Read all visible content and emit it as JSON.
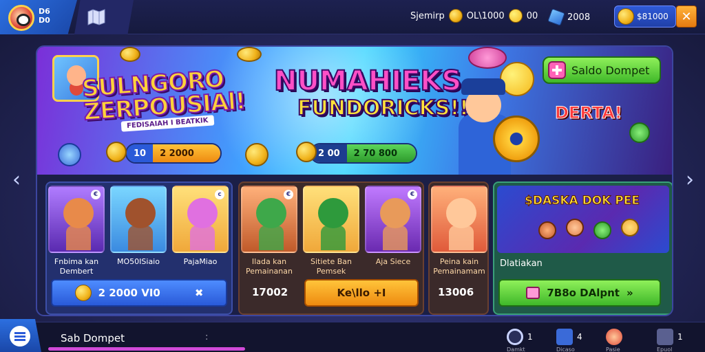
{
  "topbar": {
    "level_text": "D6\nD0",
    "stats_label": "Sjemirp",
    "stats_coins": "OL\\1000",
    "stats_value": "00",
    "gems": "2008",
    "wallet": "$81000",
    "close_glyph": "✕"
  },
  "banner": {
    "title_left": "SULNGORO ZERPOUSIAl!",
    "subtitle_left": "FEDISAIAH I BEATKIK",
    "title_main": "NUMAHIEKS",
    "title_main_2": "FUNDORICKS!!",
    "pill1_left": "10",
    "pill1_right": "2 2000",
    "pill2_left": "2 00",
    "pill2_right": "2 70 800",
    "saldo_button": "Saldo Dompet",
    "derta": "DERTA!"
  },
  "cards": {
    "group_a": {
      "labels": [
        "Fnbima kan Dembert",
        "MO50ISiaio",
        "PajaMiao"
      ],
      "badges": [
        "€",
        "",
        "c"
      ],
      "button_value": "2 2000 VI0",
      "button_icon": "✖"
    },
    "group_b": {
      "labels": [
        "Ilada kan Pemainanan",
        "Sitiete Ban Pemsek",
        "Aja Siece"
      ],
      "badges": [
        "€",
        "",
        "€"
      ],
      "value_left": "17002",
      "button_label": "Ke\\llo +I"
    },
    "orphan": {
      "label": "Peina kain Pemainamam",
      "value": "13006"
    },
    "promo": {
      "title": "$DASKA DOK PEE",
      "subtitle": "Dlatiakan",
      "button_value": "7B8o DAlpnt",
      "button_icon": "»"
    }
  },
  "bottombar": {
    "status_label": "Sab Dompet",
    "status_dots": ":",
    "nav": [
      {
        "icon": "record-icon",
        "value": "1",
        "caption": "Damkt"
      },
      {
        "icon": "gift-icon",
        "value": "4",
        "caption": "Dicaso"
      },
      {
        "icon": "profile-icon",
        "value": "",
        "caption": "Pasie"
      },
      {
        "icon": "bag-icon",
        "value": "1",
        "caption": "Epuol"
      }
    ]
  },
  "colors": {
    "accent_blue": "#2a5ad8",
    "accent_orange": "#ee8a10",
    "accent_green": "#3fb82a",
    "progress": "#d04ad8"
  }
}
